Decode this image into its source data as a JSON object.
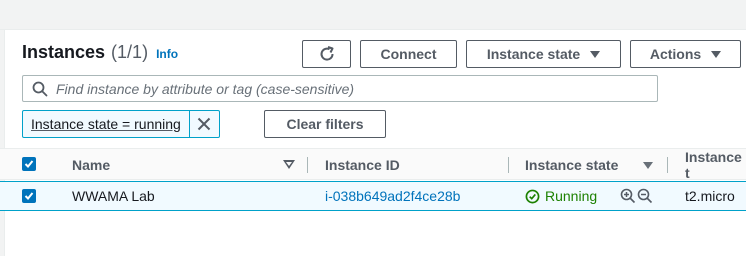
{
  "header": {
    "title": "Instances",
    "count": "(1/1)",
    "info_link": "Info"
  },
  "toolbar": {
    "refresh_icon": "refresh-icon",
    "connect_label": "Connect",
    "instance_state_label": "Instance state",
    "actions_label": "Actions"
  },
  "search": {
    "placeholder": "Find instance by attribute or tag (case-sensitive)",
    "value": ""
  },
  "filter": {
    "token_label": "Instance state = running",
    "clear_label": "Clear filters"
  },
  "table": {
    "columns": [
      "Name",
      "Instance ID",
      "Instance state",
      "Instance t"
    ],
    "rows": [
      {
        "selected": true,
        "name": "WWAMA Lab",
        "instance_id": "i-038b649ad2f4ce28b",
        "state": "Running",
        "type": "t2.micro"
      }
    ]
  },
  "colors": {
    "accent": "#0073bb",
    "running": "#1d8102",
    "selection_border": "#00a1c9"
  }
}
